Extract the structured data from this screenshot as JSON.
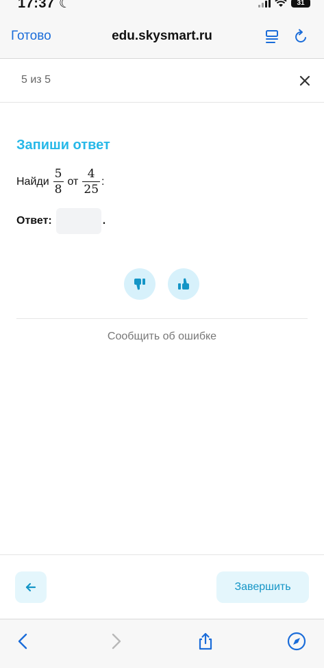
{
  "status_bar": {
    "time": "17:37",
    "battery": "31"
  },
  "browser": {
    "done_label": "Готово",
    "url": "edu.skysmart.ru"
  },
  "progress": {
    "text": "5 из 5"
  },
  "task": {
    "title": "Запиши ответ",
    "prompt_word": "Найди",
    "fraction1": {
      "numerator": "5",
      "denominator": "8"
    },
    "joiner": "от",
    "fraction2": {
      "numerator": "4",
      "denominator": "25"
    },
    "colon": ":",
    "answer_label": "Ответ:",
    "answer_value": "",
    "answer_suffix": "."
  },
  "report_link": "Сообщить об ошибке",
  "footer": {
    "finish_label": "Завершить"
  },
  "colors": {
    "accent": "#27b8e8",
    "button_bg": "#e4f6fc",
    "safari_blue": "#1a6cd9"
  }
}
